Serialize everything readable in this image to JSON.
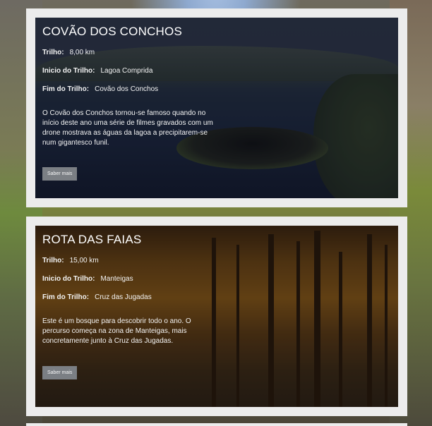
{
  "trails": [
    {
      "title": "COVÃO DOS CONCHOS",
      "distance_label": "Trilho:",
      "distance": "8,00 km",
      "start_label": "Inicio do Trilho:",
      "start": "Lagoa Comprida",
      "end_label": "Fim do Trilho:",
      "end": "Covão dos Conchos",
      "description": "O Covão dos Conchos tornou-se famoso quando no início deste ano uma série de filmes gravados com um drone mostrava as águas da lagoa a precipitarem-se num gigantesco funil.",
      "button": "Saber mais"
    },
    {
      "title": "ROTA DAS FAIAS",
      "distance_label": "Trilho:",
      "distance": "15,00 km",
      "start_label": "Inicio do Trilho:",
      "start": "Manteigas",
      "end_label": "Fim do Trilho:",
      "end": "Cruz das Jugadas",
      "description": "Este é um bosque para descobrir todo o ano. O percurso começa na zona de Manteigas, mais concretamente junto à Cruz das Jugadas.",
      "button": "Saber mais"
    }
  ]
}
